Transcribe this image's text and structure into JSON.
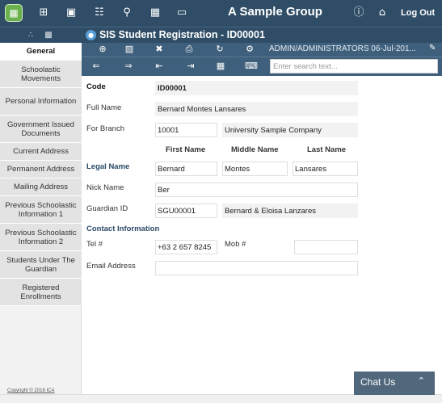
{
  "app": {
    "title": "A Sample Group",
    "logout": "Log Out"
  },
  "icons": {
    "top": [
      "logo-icon",
      "grid-icon",
      "image-icon",
      "org-chart-icon",
      "search-key-icon",
      "calendar-icon",
      "chat-bubble-icon"
    ],
    "right": [
      "help-icon",
      "home-icon"
    ]
  },
  "module": {
    "title": "SIS Student Registration - ID00001",
    "info": "ADMIN/ADMINISTRATORS 06-Jul-201..."
  },
  "search": {
    "placeholder": "Enter search text..."
  },
  "sidebar": {
    "items": [
      {
        "label": "General",
        "active": true
      },
      {
        "label": "Schoolastic Movements"
      },
      {
        "label": "Personal Information"
      },
      {
        "label": "Government Issued Documents"
      },
      {
        "label": "Current Address"
      },
      {
        "label": "Permanent Address"
      },
      {
        "label": "Mailing Address"
      },
      {
        "label": "Previous Schoolastic Information 1"
      },
      {
        "label": "Previous Schoolastic Information 2"
      },
      {
        "label": "Students Under The Guardian"
      },
      {
        "label": "Registered Enrollments"
      }
    ],
    "copyright": "Copyright © 2016 ICA"
  },
  "form": {
    "code_label": "Code",
    "code_value": "ID00001",
    "fullname_label": "Full Name",
    "fullname_value": "Bernard Montes Lansares",
    "branch_label": "For Branch",
    "branch_code": "10001",
    "branch_name": "University Sample Company",
    "first_name_header": "First Name",
    "middle_name_header": "Middle Name",
    "last_name_header": "Last Name",
    "legal_name_label": "Legal Name",
    "first_name": "Bernard",
    "middle_name": "Montes",
    "last_name": "Lansares",
    "nickname_label": "Nick Name",
    "nickname": "Ber",
    "guardian_label": "Guardian ID",
    "guardian_id": "SGU00001",
    "guardian_name": "Bernard & Eloisa Lanzares",
    "contact_section": "Contact Information",
    "tel_label": "Tel #",
    "tel": "+63 2 657 8245",
    "mob_label": "Mob #",
    "mob": "",
    "email_label": "Email Address",
    "email": ""
  },
  "chat": {
    "label": "Chat Us"
  }
}
